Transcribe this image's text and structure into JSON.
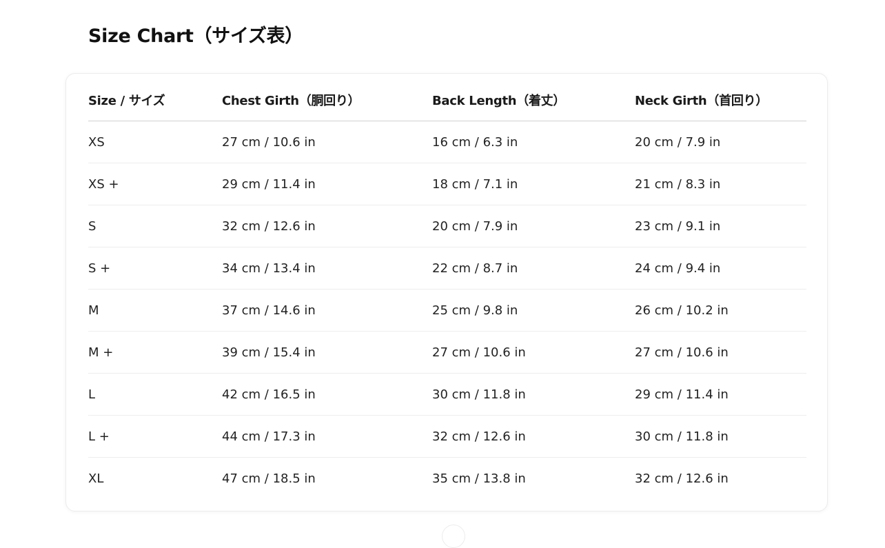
{
  "title": "Size Chart（サイズ表）",
  "table": {
    "headers": [
      "Size / サイズ",
      "Chest Girth（胴回り）",
      "Back Length（着丈）",
      "Neck Girth（首回り）"
    ],
    "rows": [
      [
        "XS",
        "27 cm / 10.6 in",
        "16 cm / 6.3 in",
        "20 cm / 7.9 in"
      ],
      [
        "XS +",
        "29 cm / 11.4 in",
        "18 cm / 7.1 in",
        "21 cm / 8.3 in"
      ],
      [
        "S",
        "32 cm / 12.6 in",
        "20 cm / 7.9 in",
        "23 cm / 9.1 in"
      ],
      [
        "S +",
        "34 cm / 13.4 in",
        "22 cm / 8.7 in",
        "24 cm / 9.4 in"
      ],
      [
        "M",
        "37 cm / 14.6 in",
        "25 cm / 9.8 in",
        "26 cm / 10.2 in"
      ],
      [
        "M +",
        "39 cm / 15.4 in",
        "27 cm / 10.6 in",
        "27 cm / 10.6 in"
      ],
      [
        "L",
        "42 cm / 16.5 in",
        "30 cm / 11.8 in",
        "29 cm / 11.4 in"
      ],
      [
        "L +",
        "44 cm / 17.3 in",
        "32 cm / 12.6 in",
        "30 cm / 11.8 in"
      ],
      [
        "XL",
        "47 cm / 18.5 in",
        "35 cm / 13.8 in",
        "32 cm / 12.6 in"
      ]
    ]
  }
}
